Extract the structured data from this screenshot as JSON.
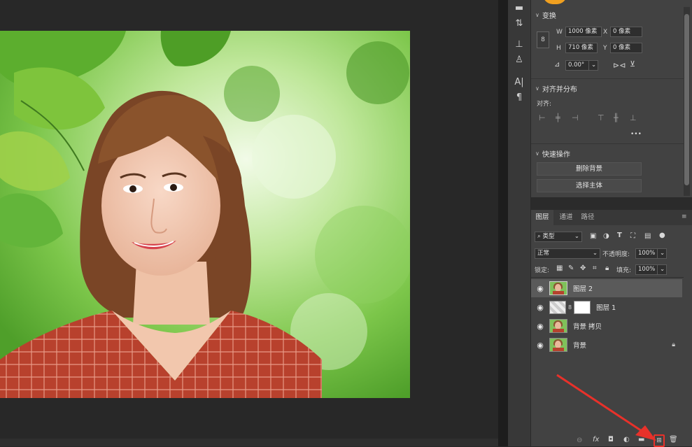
{
  "transform": {
    "title": "变换",
    "w_label": "W",
    "w_value": "1000 像素",
    "h_label": "H",
    "h_value": "710 像素",
    "x_label": "X",
    "x_value": "0 像素",
    "y_label": "Y",
    "y_value": "0 像素",
    "angle_value": "0.00°"
  },
  "align": {
    "title": "对齐并分布",
    "label": "对齐:",
    "more": "•••"
  },
  "quick_actions": {
    "title": "快速操作",
    "remove_bg": "删除背景",
    "select_subject": "选择主体"
  },
  "layers_panel": {
    "tabs": [
      "图层",
      "通道",
      "路径"
    ],
    "filter_kind": "类型",
    "blend_mode": "正常",
    "opacity_label": "不透明度:",
    "opacity_value": "100%",
    "lock_label": "锁定:",
    "fill_label": "填充:",
    "fill_value": "100%",
    "layers": [
      {
        "name": "图层 2",
        "selected": true
      },
      {
        "name": "图层 1",
        "selected": false
      },
      {
        "name": "背景 拷贝",
        "selected": false
      },
      {
        "name": "背景",
        "selected": false,
        "locked": true
      }
    ]
  },
  "colors": {
    "panel_bg": "#424242",
    "selected_row": "#5a5a5a",
    "arrow_red": "#e8312a",
    "badge_orange": "#f0a020"
  }
}
